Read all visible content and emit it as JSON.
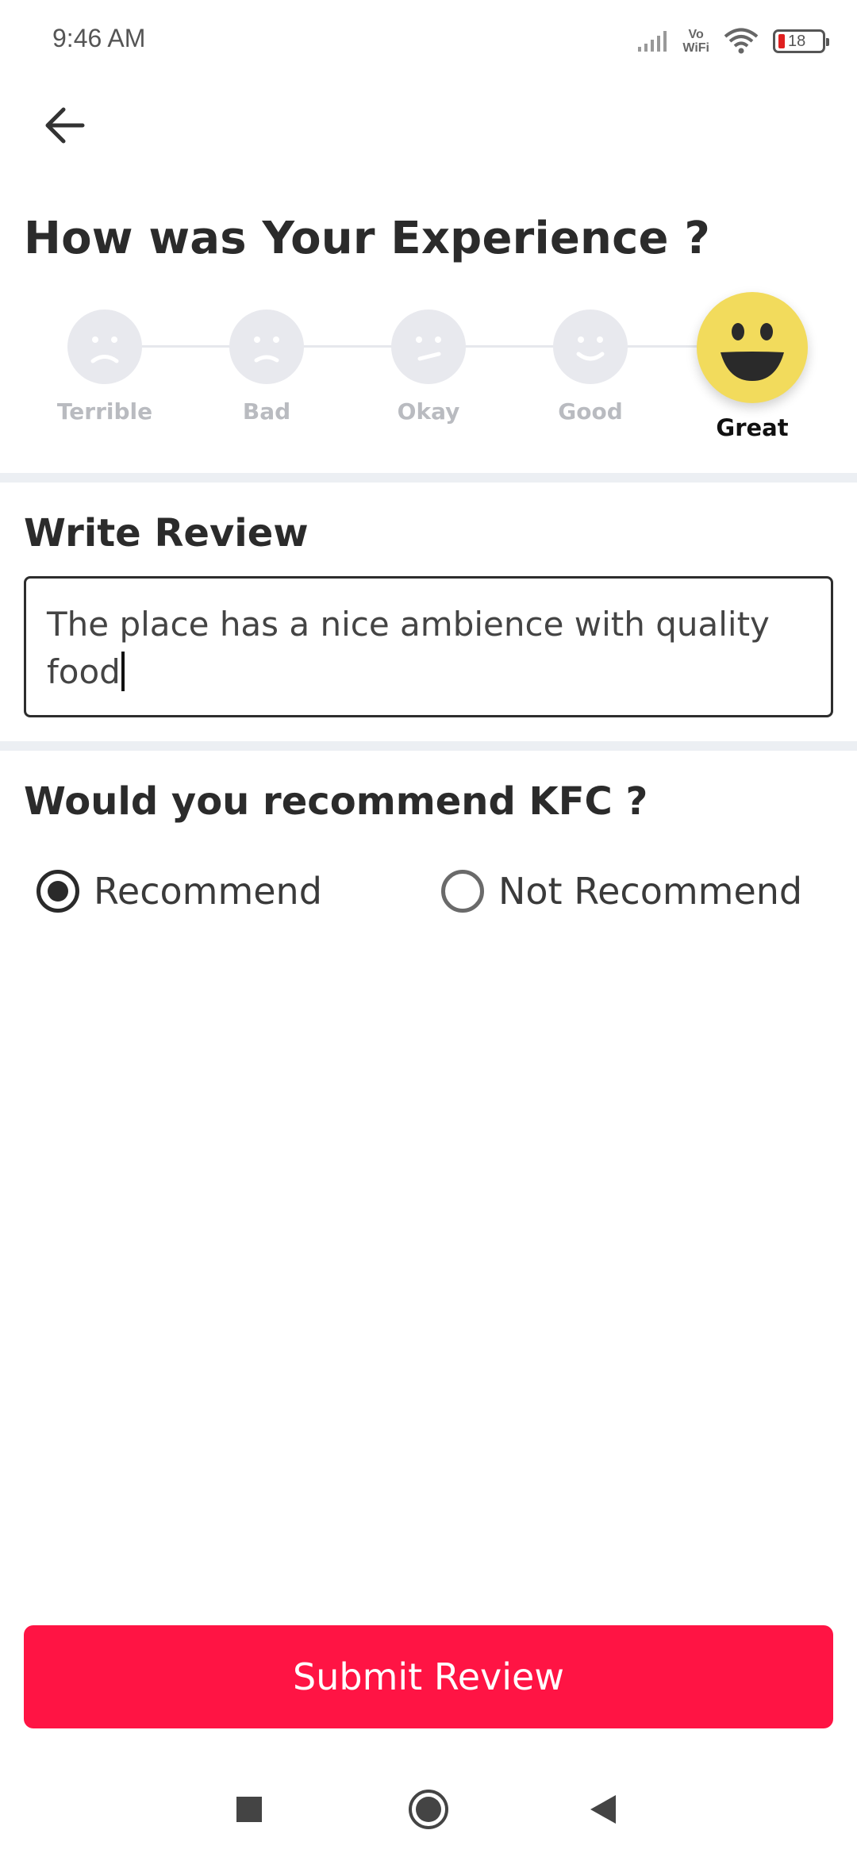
{
  "status_bar": {
    "time": "9:46 AM",
    "network_label": "Vo\nWiFi",
    "battery_level": "18"
  },
  "header": {
    "back_icon": "arrow-left-icon"
  },
  "experience": {
    "heading": "How was Your Experience ?",
    "options": [
      {
        "label": "Terrible",
        "icon": "face-terrible-icon"
      },
      {
        "label": "Bad",
        "icon": "face-bad-icon"
      },
      {
        "label": "Okay",
        "icon": "face-okay-icon"
      },
      {
        "label": "Good",
        "icon": "face-good-icon"
      },
      {
        "label": "Great",
        "icon": "face-great-icon"
      }
    ],
    "selected": "Great"
  },
  "review": {
    "title": "Write Review",
    "value": "The place has a nice ambience with quality food"
  },
  "recommend": {
    "question": "Would you recommend KFC ?",
    "options": [
      "Recommend",
      "Not Recommend"
    ],
    "selected": "Recommend"
  },
  "submit": {
    "label": "Submit Review"
  },
  "colors": {
    "accent": "#ff1444",
    "selected_face": "#f2db5c",
    "inactive_face": "#e8e9ee"
  },
  "nav": {
    "icons": [
      "recents-square-icon",
      "home-circle-icon",
      "back-triangle-icon"
    ]
  }
}
